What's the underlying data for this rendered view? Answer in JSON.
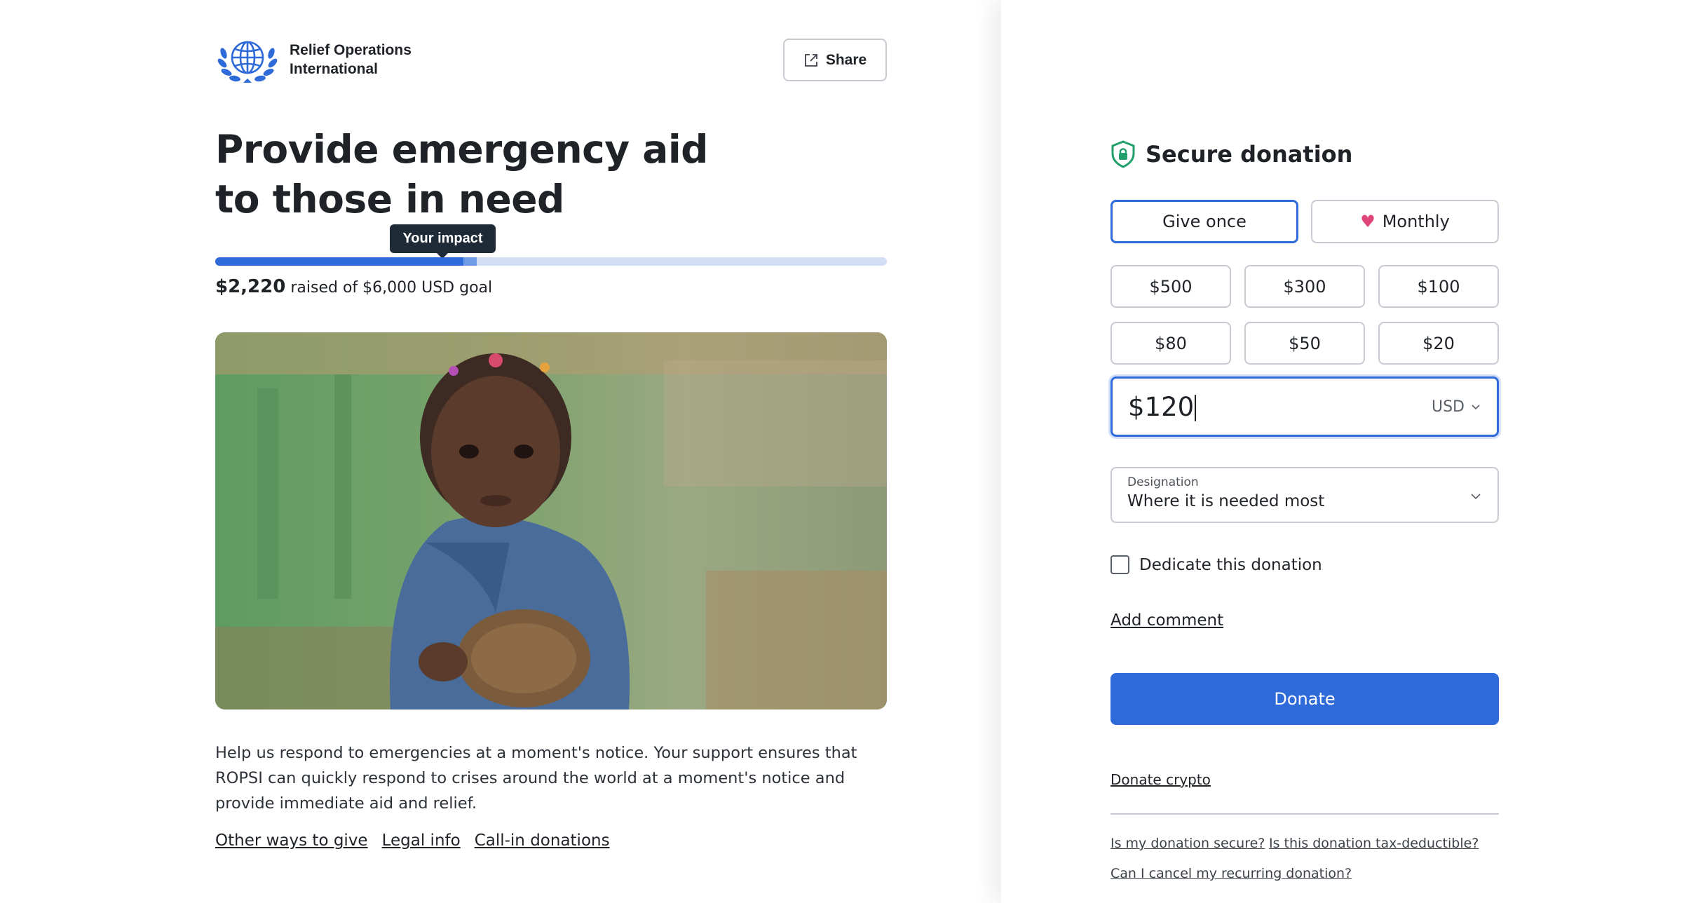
{
  "org": {
    "name_line1": "Relief Operations",
    "name_line2": "International",
    "logo_icon": "globe-wreath-icon",
    "brand_color": "#2f6ad9"
  },
  "header": {
    "share_label": "Share",
    "share_icon": "share-icon"
  },
  "campaign": {
    "title_line1": "Provide emergency aid",
    "title_line2": "to those in need",
    "impact_tooltip": "Your impact",
    "raised_amount": "$2,220",
    "raised_text": "raised of $6,000 USD goal",
    "progress_raised_fraction": 0.37,
    "progress_impact_fraction": 0.02,
    "photo_alt": "child-photo",
    "description": "Help us respond to emergencies at a moment's notice. Your support ensures that ROPSI can quickly respond to crises around the world at a moment's notice and provide immediate aid and relief.",
    "links": [
      "Other ways to give",
      "Legal info",
      "Call-in donations"
    ]
  },
  "donation": {
    "title": "Secure donation",
    "title_icon": "shield-lock-icon",
    "frequency": {
      "once": "Give once",
      "monthly": "Monthly",
      "selected": "once"
    },
    "amounts": [
      "$500",
      "$300",
      "$100",
      "$80",
      "$50",
      "$20"
    ],
    "amount_value": "$120",
    "currency": "USD",
    "designation_label": "Designation",
    "designation_value": "Where it is needed most",
    "dedicate_label": "Dedicate this donation",
    "dedicate_checked": false,
    "add_comment": "Add comment",
    "donate_label": "Donate",
    "crypto_label": "Donate crypto",
    "faq": [
      "Is my donation secure?",
      "Is this donation tax-deductible?",
      "Can I cancel my recurring donation?"
    ]
  }
}
